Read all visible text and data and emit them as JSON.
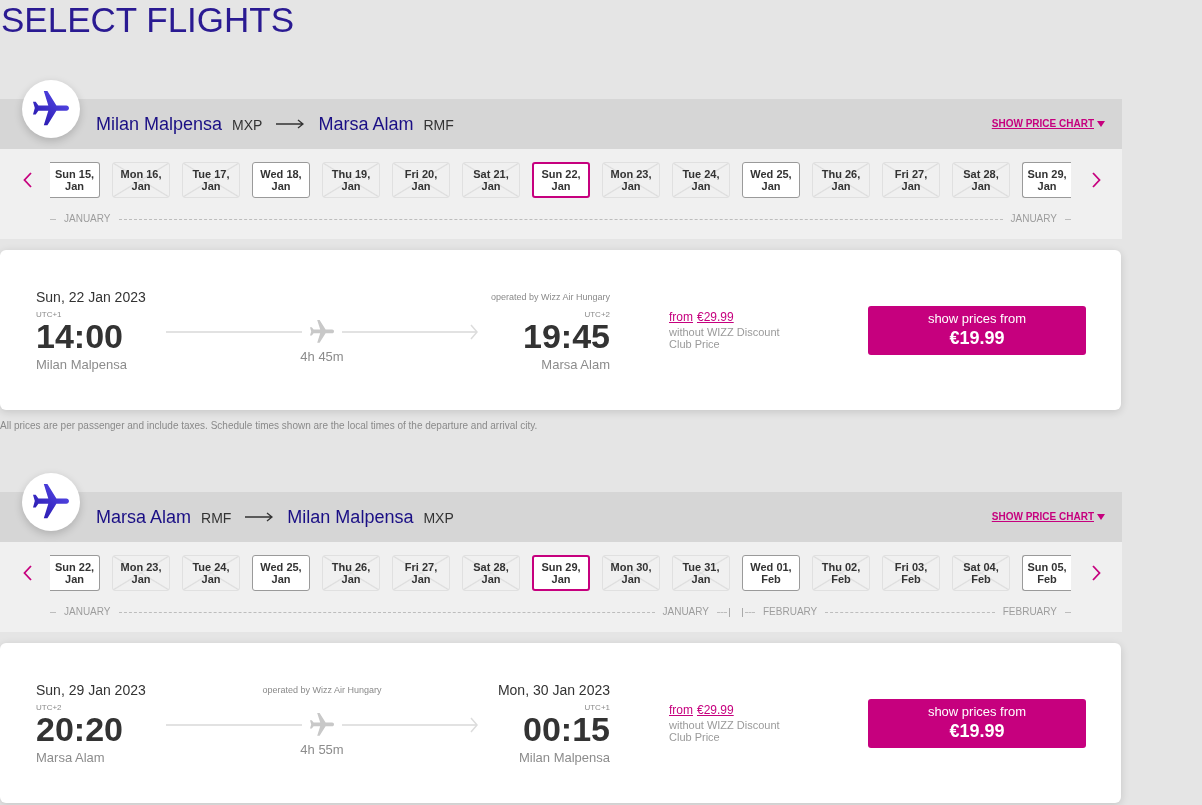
{
  "page_title": "SELECT FLIGHTS",
  "journeys": [
    {
      "origin": {
        "city": "Milan Malpensa",
        "code": "MXP"
      },
      "destination": {
        "city": "Marsa Alam",
        "code": "RMF"
      },
      "price_chart_link": "SHOW PRICE CHART",
      "months": [
        {
          "start_label": "JANUARY",
          "end_label": "JANUARY",
          "dates": [
            {
              "day": "Sun 15,",
              "month": "Jan",
              "available": true,
              "selected": false
            },
            {
              "day": "Mon 16,",
              "month": "Jan",
              "available": false,
              "selected": false
            },
            {
              "day": "Tue 17,",
              "month": "Jan",
              "available": false,
              "selected": false
            },
            {
              "day": "Wed 18,",
              "month": "Jan",
              "available": true,
              "selected": false
            },
            {
              "day": "Thu 19,",
              "month": "Jan",
              "available": false,
              "selected": false
            },
            {
              "day": "Fri 20,",
              "month": "Jan",
              "available": false,
              "selected": false
            },
            {
              "day": "Sat 21,",
              "month": "Jan",
              "available": false,
              "selected": false
            },
            {
              "day": "Sun 22,",
              "month": "Jan",
              "available": true,
              "selected": true
            },
            {
              "day": "Mon 23,",
              "month": "Jan",
              "available": false,
              "selected": false
            },
            {
              "day": "Tue 24,",
              "month": "Jan",
              "available": false,
              "selected": false
            },
            {
              "day": "Wed 25,",
              "month": "Jan",
              "available": true,
              "selected": false
            },
            {
              "day": "Thu 26,",
              "month": "Jan",
              "available": false,
              "selected": false
            },
            {
              "day": "Fri 27,",
              "month": "Jan",
              "available": false,
              "selected": false
            },
            {
              "day": "Sat 28,",
              "month": "Jan",
              "available": false,
              "selected": false
            },
            {
              "day": "Sun 29,",
              "month": "Jan",
              "available": true,
              "selected": false
            }
          ]
        }
      ],
      "flight": {
        "departure": {
          "date": "Sun, 22 Jan 2023",
          "utc": "UTC+1",
          "time": "14:00",
          "city": "Milan Malpensa"
        },
        "arrival": {
          "utc": "UTC+2",
          "time": "19:45",
          "city": "Marsa Alam"
        },
        "operator": "operated by Wizz Air Hungary",
        "duration": "4h 45m",
        "regular_price": {
          "from_label": "from",
          "price": "€29.99",
          "note": "without WIZZ Discount Club Price"
        },
        "button": {
          "label": "show prices from",
          "price": "€19.99"
        }
      },
      "note": "All prices are per passenger and include taxes. Schedule times shown are the local times of the departure and arrival city."
    },
    {
      "origin": {
        "city": "Marsa Alam",
        "code": "RMF"
      },
      "destination": {
        "city": "Milan Malpensa",
        "code": "MXP"
      },
      "price_chart_link": "SHOW PRICE CHART",
      "months": [
        {
          "start_label": "JANUARY",
          "end_label": "JANUARY",
          "dates": [
            {
              "day": "Sun 22,",
              "month": "Jan",
              "available": true,
              "selected": false
            },
            {
              "day": "Mon 23,",
              "month": "Jan",
              "available": false,
              "selected": false
            },
            {
              "day": "Tue 24,",
              "month": "Jan",
              "available": false,
              "selected": false
            },
            {
              "day": "Wed 25,",
              "month": "Jan",
              "available": true,
              "selected": false
            },
            {
              "day": "Thu 26,",
              "month": "Jan",
              "available": false,
              "selected": false
            },
            {
              "day": "Fri 27,",
              "month": "Jan",
              "available": false,
              "selected": false
            },
            {
              "day": "Sat 28,",
              "month": "Jan",
              "available": false,
              "selected": false
            },
            {
              "day": "Sun 29,",
              "month": "Jan",
              "available": true,
              "selected": true
            },
            {
              "day": "Mon 30,",
              "month": "Jan",
              "available": false,
              "selected": false
            },
            {
              "day": "Tue 31,",
              "month": "Jan",
              "available": false,
              "selected": false
            }
          ]
        },
        {
          "start_label": "FEBRUARY",
          "end_label": "FEBRUARY",
          "dates": [
            {
              "day": "Wed 01,",
              "month": "Feb",
              "available": true,
              "selected": false
            },
            {
              "day": "Thu 02,",
              "month": "Feb",
              "available": false,
              "selected": false
            },
            {
              "day": "Fri 03,",
              "month": "Feb",
              "available": false,
              "selected": false
            },
            {
              "day": "Sat 04,",
              "month": "Feb",
              "available": false,
              "selected": false
            },
            {
              "day": "Sun 05,",
              "month": "Feb",
              "available": true,
              "selected": false
            }
          ]
        }
      ],
      "flight": {
        "departure": {
          "date": "Sun, 29 Jan 2023",
          "utc": "UTC+2",
          "time": "20:20",
          "city": "Marsa Alam"
        },
        "arrival": {
          "date": "Mon, 30 Jan 2023",
          "utc": "UTC+1",
          "time": "00:15",
          "city": "Milan Malpensa"
        },
        "operator": "operated by Wizz Air Hungary",
        "duration": "4h 55m",
        "regular_price": {
          "from_label": "from",
          "price": "€29.99",
          "note": "without WIZZ Discount Club Price"
        },
        "button": {
          "label": "show prices from",
          "price": "€19.99"
        }
      }
    }
  ]
}
